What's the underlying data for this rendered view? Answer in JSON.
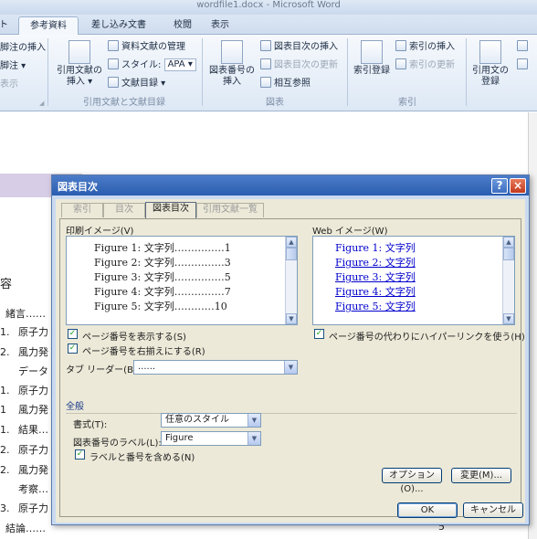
{
  "window": {
    "title": "wordfile1.docx - Microsoft Word"
  },
  "ribbon_tabs": [
    {
      "label": "ト"
    },
    {
      "label": "参考資料"
    },
    {
      "label": "差し込み文書"
    },
    {
      "label": "校閲"
    },
    {
      "label": "表示"
    }
  ],
  "ribbon": {
    "left_fragments": [
      "脚注の挿入",
      "脚注 ▾",
      "表示"
    ],
    "citations": {
      "insert_citation": "引用文献の\n挿入 ▾",
      "manage_sources": "資料文献の管理",
      "style_label": "スタイル:",
      "style_value": "APA",
      "bibliography": "文献目録 ▾",
      "group_label": "引用文献と文献目録"
    },
    "captions": {
      "insert_caption": "図表番号の\n挿入",
      "insert_table_of_figures": "図表目次の挿入",
      "update_table": "図表目次の更新",
      "cross_reference": "相互参照",
      "group_label": "図表"
    },
    "index": {
      "mark_entry": "索引登録",
      "insert_index": "索引の挿入",
      "update_index": "索引の更新",
      "group_label": "索引"
    },
    "toa": {
      "mark_citation": "引用文の\n登録"
    }
  },
  "document": {
    "heading_fragment": "容",
    "lines": [
      {
        "num": "",
        "text": "緒言……"
      },
      {
        "num": "1.",
        "text": "原子力"
      },
      {
        "num": "2.",
        "text": "風力発"
      },
      {
        "num": "",
        "text": "データ"
      },
      {
        "num": "1.",
        "text": "原子力"
      },
      {
        "num": "1",
        "text": "風力発"
      },
      {
        "num": "1.",
        "text": "結果…"
      },
      {
        "num": "2.",
        "text": "原子力"
      },
      {
        "num": "2.",
        "text": "風力発"
      },
      {
        "num": "",
        "text": "考察…"
      },
      {
        "num": "3.",
        "text": "原子力"
      },
      {
        "num": "",
        "text": "結論……"
      }
    ],
    "last_page_num": "5"
  },
  "dialog": {
    "title": "図表目次",
    "help_label": "?",
    "close_label": "×",
    "tabs": [
      {
        "label": "索引"
      },
      {
        "label": "目次"
      },
      {
        "label": "図表目次"
      },
      {
        "label": "引用文献一覧"
      }
    ],
    "print_preview_label": "印刷イメージ(V)",
    "print_preview_lines": [
      {
        "caption": "Figure 1: 文字列",
        "dots": "……………",
        "page": "1"
      },
      {
        "caption": "Figure 2: 文字列",
        "dots": "……………",
        "page": "3"
      },
      {
        "caption": "Figure 3: 文字列",
        "dots": "……………",
        "page": "5"
      },
      {
        "caption": "Figure 4: 文字列",
        "dots": "……………",
        "page": "7"
      },
      {
        "caption": "Figure 5: 文字列",
        "dots": "…………",
        "page": "10"
      }
    ],
    "web_preview_label": "Web イメージ(W)",
    "web_preview_lines": [
      "Figure 1: 文字列",
      "Figure 2: 文字列",
      "Figure 3: 文字列",
      "Figure 4: 文字列",
      "Figure 5: 文字列"
    ],
    "show_page_numbers_label": "ページ番号を表示する(S)",
    "right_align_page_numbers_label": "ページ番号を右揃えにする(R)",
    "use_hyperlinks_label": "ページ番号の代わりにハイパーリンクを使う(H)",
    "tab_leader_label": "タブ リーダー(B):",
    "tab_leader_value": "......",
    "general_label": "全般",
    "formats_label": "書式(T):",
    "formats_value": "任意のスタイル",
    "caption_label_label": "図表番号のラベル(L):",
    "caption_label_value": "Figure",
    "include_label_label": "ラベルと番号を含める(N)",
    "options_button": "オプション(O)...",
    "modify_button": "変更(M)...",
    "ok_button": "OK",
    "cancel_button": "キャンセル"
  },
  "colors": {
    "dialog_titlebar": "#2a5db0",
    "dialog_body": "#ece9d8",
    "hyperlink": "#0000cc",
    "check": "#21a121"
  }
}
